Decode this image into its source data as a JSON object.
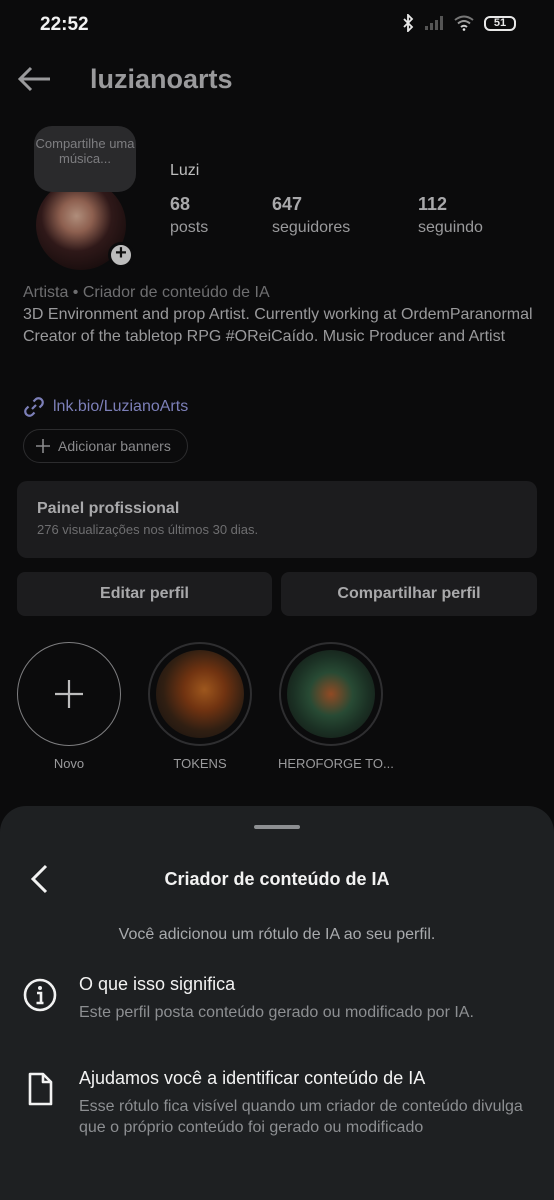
{
  "status_bar": {
    "time": "22:52",
    "battery": "51",
    "icons": [
      "bluetooth-icon",
      "signal-icon",
      "wifi-icon",
      "battery-icon"
    ]
  },
  "header": {
    "username": "luzianoarts",
    "back_icon": "arrow-left-icon"
  },
  "profile": {
    "note_bubble": "Compartilhe uma música...",
    "full_name": "Luzi",
    "stats": [
      {
        "value": "68",
        "label": "posts"
      },
      {
        "value": "647",
        "label": "seguidores"
      },
      {
        "value": "112",
        "label": "seguindo"
      }
    ],
    "category": "Artista • Criador de conteúdo de IA",
    "bio_line1": "3D Environment and prop Artist. Currently working at OrdemParanormal",
    "bio_line2": "Creator of the tabletop RPG #OReiCaído. Music Producer and Artist",
    "link": "lnk.bio/LuzianoArts",
    "add_banners": "Adicionar banners"
  },
  "professional_panel": {
    "title": "Painel profissional",
    "subtitle": "276 visualizações nos últimos 30 dias."
  },
  "buttons": {
    "edit": "Editar perfil",
    "share": "Compartilhar perfil"
  },
  "highlights": [
    {
      "label": "Novo"
    },
    {
      "label": "TOKENS"
    },
    {
      "label": "HEROFORGE TO..."
    }
  ],
  "sheet": {
    "title": "Criador de conteúdo de IA",
    "description": "Você adicionou um rótulo de IA ao seu perfil.",
    "items": [
      {
        "icon": "info-icon",
        "title": "O que isso significa",
        "subtitle": "Este perfil posta conteúdo gerado ou modificado por IA."
      },
      {
        "icon": "document-icon",
        "title": "Ajudamos você a identificar conteúdo de IA",
        "subtitle": "Esse rótulo fica visível quando um criador de conteúdo divulga que o próprio conteúdo foi gerado ou modificado"
      }
    ]
  },
  "colors": {
    "background": "#0b0b0c",
    "sheet": "#1e2022",
    "link": "#7c7fb8"
  }
}
